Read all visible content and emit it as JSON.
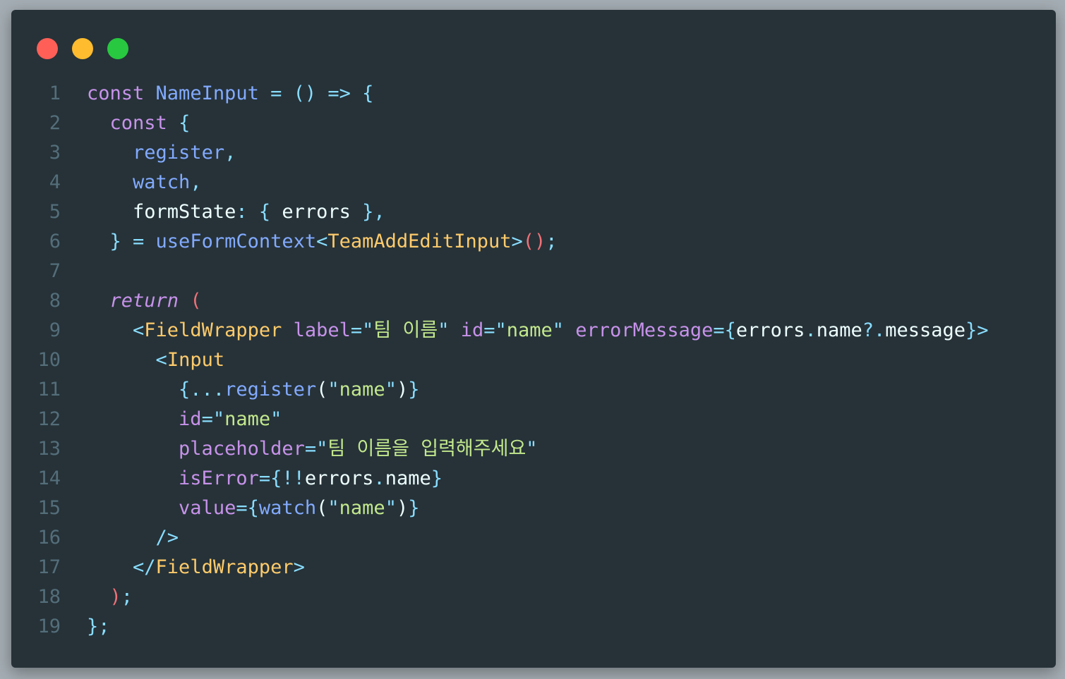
{
  "window": {
    "controls": [
      {
        "name": "close",
        "color": "#ff5f57"
      },
      {
        "name": "minimize",
        "color": "#febc2e"
      },
      {
        "name": "maximize",
        "color": "#28c840"
      }
    ]
  },
  "colors": {
    "background": "#263238",
    "keyword": "#c792ea",
    "function": "#82aaff",
    "punctuation": "#89ddff",
    "type": "#ffcb6b",
    "string": "#c3e88d",
    "paren": "#f07178",
    "text": "#eeffff",
    "line_number": "#546e7a"
  },
  "code": {
    "lines": [
      {
        "number": "1",
        "tokens": [
          {
            "t": "key",
            "v": "const "
          },
          {
            "t": "fn",
            "v": "NameInput "
          },
          {
            "t": "punc",
            "v": "= () => {"
          }
        ]
      },
      {
        "number": "2",
        "tokens": [
          {
            "t": "text",
            "v": "  "
          },
          {
            "t": "key",
            "v": "const "
          },
          {
            "t": "punc",
            "v": "{"
          }
        ]
      },
      {
        "number": "3",
        "tokens": [
          {
            "t": "text",
            "v": "    "
          },
          {
            "t": "fn",
            "v": "register"
          },
          {
            "t": "punc",
            "v": ","
          }
        ]
      },
      {
        "number": "4",
        "tokens": [
          {
            "t": "text",
            "v": "    "
          },
          {
            "t": "fn",
            "v": "watch"
          },
          {
            "t": "punc",
            "v": ","
          }
        ]
      },
      {
        "number": "5",
        "tokens": [
          {
            "t": "text",
            "v": "    formState"
          },
          {
            "t": "punc",
            "v": ": { "
          },
          {
            "t": "text",
            "v": "errors "
          },
          {
            "t": "punc",
            "v": "},"
          }
        ]
      },
      {
        "number": "6",
        "tokens": [
          {
            "t": "text",
            "v": "  "
          },
          {
            "t": "punc",
            "v": "} = "
          },
          {
            "t": "fn",
            "v": "useFormContext"
          },
          {
            "t": "punc",
            "v": "<"
          },
          {
            "t": "type",
            "v": "TeamAddEditInput"
          },
          {
            "t": "punc",
            "v": ">"
          },
          {
            "t": "paren",
            "v": "()"
          },
          {
            "t": "punc",
            "v": ";"
          }
        ]
      },
      {
        "number": "7",
        "tokens": []
      },
      {
        "number": "8",
        "tokens": [
          {
            "t": "text",
            "v": "  "
          },
          {
            "t": "ital",
            "v": "return "
          },
          {
            "t": "paren",
            "v": "("
          }
        ]
      },
      {
        "number": "9",
        "tokens": [
          {
            "t": "text",
            "v": "    "
          },
          {
            "t": "punc",
            "v": "<"
          },
          {
            "t": "type",
            "v": "FieldWrapper "
          },
          {
            "t": "key",
            "v": "label"
          },
          {
            "t": "punc",
            "v": "=\""
          },
          {
            "t": "str",
            "v": "팀 이름"
          },
          {
            "t": "punc",
            "v": "\" "
          },
          {
            "t": "key",
            "v": "id"
          },
          {
            "t": "punc",
            "v": "=\""
          },
          {
            "t": "str",
            "v": "name"
          },
          {
            "t": "punc",
            "v": "\" "
          },
          {
            "t": "key",
            "v": "errorMessage"
          },
          {
            "t": "punc",
            "v": "={"
          },
          {
            "t": "text",
            "v": "errors"
          },
          {
            "t": "punc",
            "v": "."
          },
          {
            "t": "text",
            "v": "name"
          },
          {
            "t": "punc",
            "v": "?."
          },
          {
            "t": "text",
            "v": "message"
          },
          {
            "t": "punc",
            "v": "}>"
          }
        ]
      },
      {
        "number": "10",
        "tokens": [
          {
            "t": "text",
            "v": "      "
          },
          {
            "t": "punc",
            "v": "<"
          },
          {
            "t": "type",
            "v": "Input"
          }
        ]
      },
      {
        "number": "11",
        "tokens": [
          {
            "t": "text",
            "v": "        "
          },
          {
            "t": "punc",
            "v": "{..."
          },
          {
            "t": "fn",
            "v": "register"
          },
          {
            "t": "text",
            "v": "("
          },
          {
            "t": "punc",
            "v": "\""
          },
          {
            "t": "str",
            "v": "name"
          },
          {
            "t": "punc",
            "v": "\""
          },
          {
            "t": "text",
            "v": ")"
          },
          {
            "t": "punc",
            "v": "}"
          }
        ]
      },
      {
        "number": "12",
        "tokens": [
          {
            "t": "text",
            "v": "        "
          },
          {
            "t": "key",
            "v": "id"
          },
          {
            "t": "punc",
            "v": "=\""
          },
          {
            "t": "str",
            "v": "name"
          },
          {
            "t": "punc",
            "v": "\""
          }
        ]
      },
      {
        "number": "13",
        "tokens": [
          {
            "t": "text",
            "v": "        "
          },
          {
            "t": "key",
            "v": "placeholder"
          },
          {
            "t": "punc",
            "v": "=\""
          },
          {
            "t": "str",
            "v": "팀 이름을 입력해주세요"
          },
          {
            "t": "punc",
            "v": "\""
          }
        ]
      },
      {
        "number": "14",
        "tokens": [
          {
            "t": "text",
            "v": "        "
          },
          {
            "t": "key",
            "v": "isError"
          },
          {
            "t": "punc",
            "v": "={!!"
          },
          {
            "t": "text",
            "v": "errors"
          },
          {
            "t": "punc",
            "v": "."
          },
          {
            "t": "text",
            "v": "name"
          },
          {
            "t": "punc",
            "v": "}"
          }
        ]
      },
      {
        "number": "15",
        "tokens": [
          {
            "t": "text",
            "v": "        "
          },
          {
            "t": "key",
            "v": "value"
          },
          {
            "t": "punc",
            "v": "={"
          },
          {
            "t": "fn",
            "v": "watch"
          },
          {
            "t": "text",
            "v": "("
          },
          {
            "t": "punc",
            "v": "\""
          },
          {
            "t": "str",
            "v": "name"
          },
          {
            "t": "punc",
            "v": "\""
          },
          {
            "t": "text",
            "v": ")"
          },
          {
            "t": "punc",
            "v": "}"
          }
        ]
      },
      {
        "number": "16",
        "tokens": [
          {
            "t": "text",
            "v": "      "
          },
          {
            "t": "punc",
            "v": "/>"
          }
        ]
      },
      {
        "number": "17",
        "tokens": [
          {
            "t": "text",
            "v": "    "
          },
          {
            "t": "punc",
            "v": "</"
          },
          {
            "t": "type",
            "v": "FieldWrapper"
          },
          {
            "t": "punc",
            "v": ">"
          }
        ]
      },
      {
        "number": "18",
        "tokens": [
          {
            "t": "text",
            "v": "  "
          },
          {
            "t": "paren",
            "v": ")"
          },
          {
            "t": "punc",
            "v": ";"
          }
        ]
      },
      {
        "number": "19",
        "tokens": [
          {
            "t": "punc",
            "v": "};"
          }
        ]
      }
    ]
  }
}
